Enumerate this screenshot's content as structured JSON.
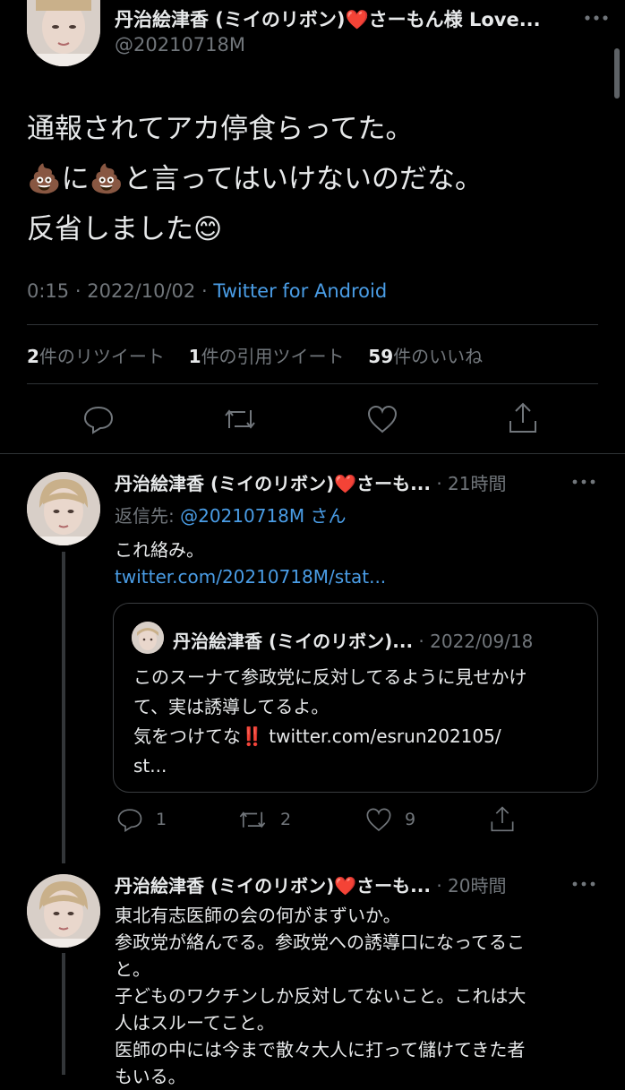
{
  "main_tweet": {
    "display_name": "丹治絵津香 (ミイのリボン)❤️さーもん様 Love...",
    "handle": "@20210718M",
    "text_lines": [
      "通報されてアカ停食らってた。",
      "💩に💩と言ってはいけないのだな。",
      "反省しました😊"
    ],
    "time": "0:15",
    "date": "2022/10/02",
    "source": "Twitter for Android",
    "retweets_count": "2",
    "retweets_label": "件のリツイート",
    "quotes_count": "1",
    "quotes_label": "件の引用ツイート",
    "likes_count": "59",
    "likes_label": "件のいいね"
  },
  "reply1": {
    "display_name": "丹治絵津香 (ミイのリボン)❤️さーも...",
    "time_ago": "21時間",
    "reply_to_label": "返信先:",
    "reply_to_handle": "@20210718M",
    "reply_to_suffix": "さん",
    "text": "これ絡み。",
    "link": "twitter.com/20210718M/stat...",
    "quote": {
      "display_name": "丹治絵津香 (ミイのリボン)...",
      "date": "2022/09/18",
      "text_lines": [
        "このスーナて参政党に反対してるように見せかけ",
        "て、実は誘導してるよ。",
        "気をつけてな‼️ twitter.com/esrun202105/",
        "st..."
      ]
    },
    "replies_count": "1",
    "retweets_count": "2",
    "likes_count": "9"
  },
  "reply2": {
    "display_name": "丹治絵津香 (ミイのリボン)❤️さーも...",
    "time_ago": "20時間",
    "text_lines": [
      "東北有志医師の会の何がまずいか。",
      "参政党が絡んでる。参政党への誘導口になってるこ",
      "と。",
      "子どものワクチンしか反対してないこと。これは大",
      "人はスルーてこと。",
      "医師の中には今まで散々大人に打って儲けてきた者",
      "もいる。"
    ]
  },
  "colors": {
    "link": "#4a9de6",
    "muted": "#71767b",
    "text": "#e7e9ea",
    "background": "#000000"
  }
}
